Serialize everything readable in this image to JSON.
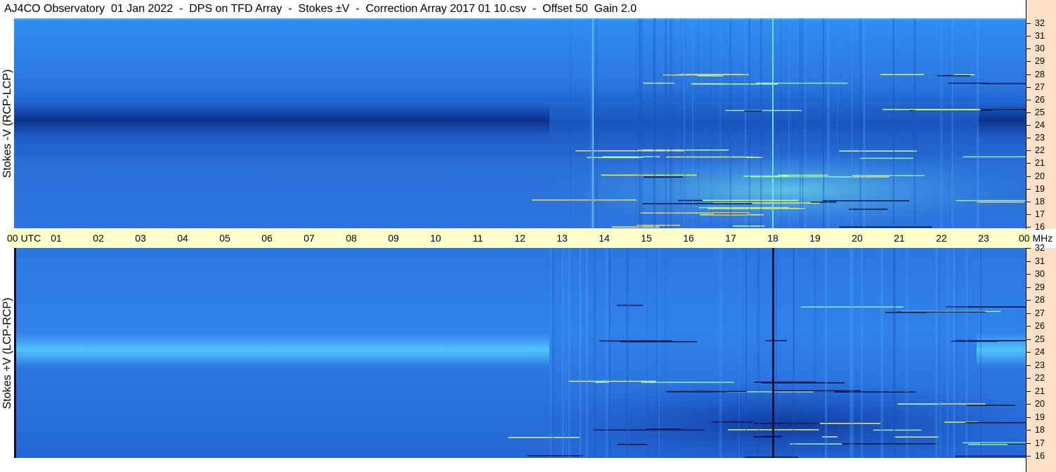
{
  "title": "AJ4CO Observatory  01 Jan 2022  -  DPS on TFD Array  -  Stokes ±V  -  Correction Array 2017 01 10.csv  -  Offset 50  Gain 2.0",
  "panels": {
    "top": {
      "ylabel": "Stokes -V (RCP-LCP)"
    },
    "bottom": {
      "ylabel": "Stokes +V (LCP-RCP)"
    }
  },
  "time_axis": {
    "ticks": [
      "00 UTC",
      "01",
      "02",
      "03",
      "04",
      "05",
      "06",
      "07",
      "08",
      "09",
      "10",
      "11",
      "12",
      "13",
      "14",
      "15",
      "16",
      "17",
      "18",
      "19",
      "20",
      "21",
      "22",
      "23",
      "00 MHz"
    ]
  },
  "freq_axis": {
    "ticks": [
      "32",
      "31",
      "30",
      "29",
      "28",
      "27",
      "26",
      "25",
      "24",
      "23",
      "22",
      "21",
      "20",
      "19",
      "18",
      "17",
      "16"
    ]
  },
  "colors": {
    "background": "#2a6fe0",
    "band_light": "#5fc8ff",
    "band_dark": "#0c3a9a",
    "axis_bg": "#fde0c5",
    "utc_bg": "#ffffcc",
    "burst_yellow": "#e8f05a",
    "burst_dark": "#06124a"
  }
}
